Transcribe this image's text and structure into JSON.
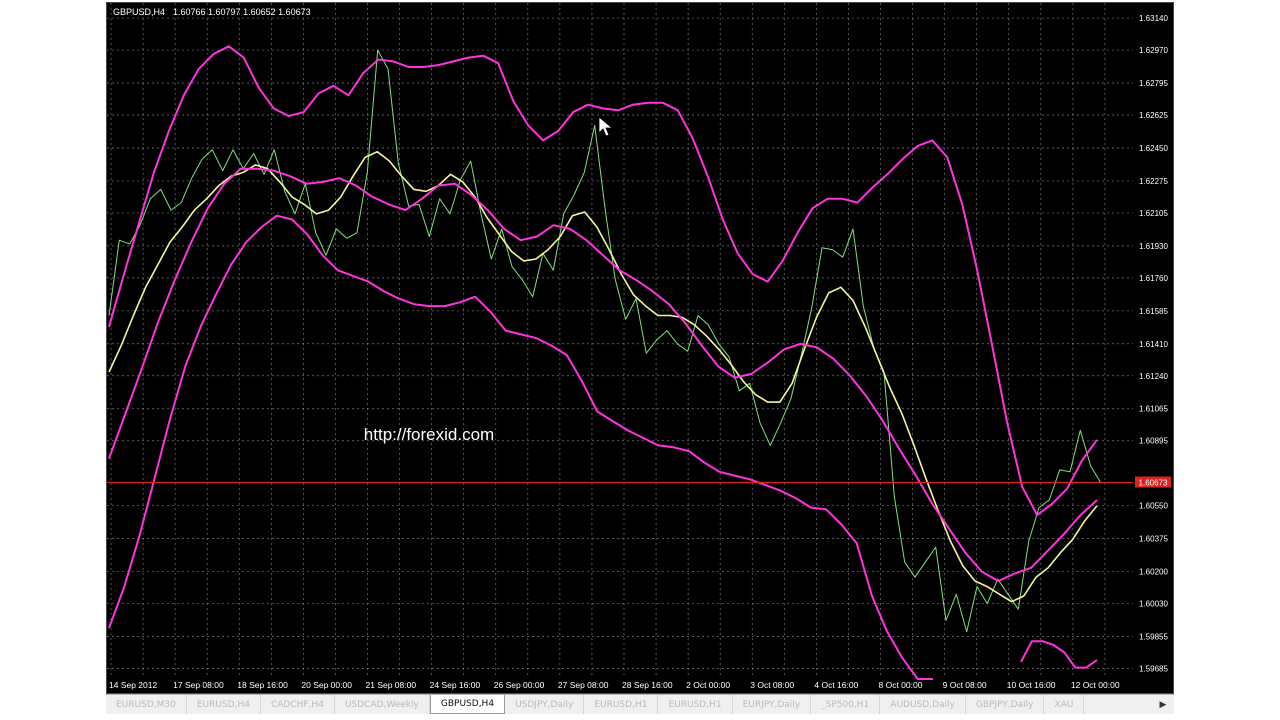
{
  "header": {
    "symbol": "GBPUSD,H4",
    "ohlc": "1.60766 1.60797 1.60652 1.60673"
  },
  "watermark": "http://forexid.com",
  "current_price_label": "1.60673",
  "tabs": [
    {
      "label": "EURUSD,M30",
      "active": false
    },
    {
      "label": "EURUSD,H4",
      "active": false
    },
    {
      "label": "CADCHF,H4",
      "active": false
    },
    {
      "label": "USDCAD,Weekly",
      "active": false
    },
    {
      "label": "GBPUSD,H4",
      "active": true
    },
    {
      "label": "USDJPY,Daily",
      "active": false
    },
    {
      "label": "EURUSD,H1",
      "active": false
    },
    {
      "label": "EURUSD,H1",
      "active": false
    },
    {
      "label": "EURJPY,Daily",
      "active": false
    },
    {
      "label": "_SP500,H1",
      "active": false
    },
    {
      "label": "AUDUSD,Daily",
      "active": false
    },
    {
      "label": "GBPJPY,Daily",
      "active": false
    },
    {
      "label": "XAU",
      "active": false
    }
  ],
  "tab_scroll_icon": "chevron-right-icon",
  "colors": {
    "background": "#000000",
    "grid": "#9aa0a6",
    "price_line": "#7fe07f",
    "ma_line": "#f5f59a",
    "band_line": "#ff33dd",
    "current_price": "#dd2222",
    "axis_text": "#ffffff"
  },
  "chart_data": {
    "type": "line",
    "y_ticks": [
      "1.63140",
      "1.62970",
      "1.62795",
      "1.62625",
      "1.62450",
      "1.62275",
      "1.62105",
      "1.61930",
      "1.61760",
      "1.61585",
      "1.61410",
      "1.61240",
      "1.61065",
      "1.60895",
      "1.60550",
      "1.60375",
      "1.60200",
      "1.60030",
      "1.59855",
      "1.59685"
    ],
    "ylim": [
      1.5964,
      1.6322
    ],
    "x_labels": [
      "14 Sep 2012",
      "17 Sep 08:00",
      "18 Sep 16:00",
      "20 Sep 00:00",
      "21 Sep 08:00",
      "24 Sep 16:00",
      "26 Sep 00:00",
      "27 Sep 08:00",
      "28 Sep 16:00",
      "2 Oct 00:00",
      "3 Oct 08:00",
      "4 Oct 16:00",
      "8 Oct 00:00",
      "9 Oct 08:00",
      "10 Oct 16:00",
      "12 Oct 00:00"
    ],
    "current_price": 1.60673,
    "grid": true,
    "series": [
      {
        "role": "price",
        "values": [
          1.6156,
          1.6196,
          1.6194,
          1.6204,
          1.6218,
          1.6223,
          1.6212,
          1.6216,
          1.6229,
          1.6239,
          1.6244,
          1.6233,
          1.6244,
          1.6234,
          1.6242,
          1.6231,
          1.6244,
          1.6222,
          1.621,
          1.6226,
          1.62,
          1.6188,
          1.6202,
          1.6197,
          1.62,
          1.6232,
          1.6297,
          1.6287,
          1.6237,
          1.6214,
          1.6215,
          1.6198,
          1.6218,
          1.621,
          1.6228,
          1.6238,
          1.621,
          1.6186,
          1.6202,
          1.6182,
          1.6175,
          1.6166,
          1.6189,
          1.618,
          1.621,
          1.622,
          1.6232,
          1.6257,
          1.6213,
          1.6175,
          1.6154,
          1.6165,
          1.6136,
          1.6143,
          1.6148,
          1.6141,
          1.6137,
          1.6156,
          1.6151,
          1.6141,
          1.6134,
          1.6116,
          1.612,
          1.6099,
          1.6087,
          1.6099,
          1.6112,
          1.6135,
          1.616,
          1.6192,
          1.6191,
          1.6187,
          1.6202,
          1.6161,
          1.6139,
          1.6126,
          1.606,
          1.6025,
          1.6017,
          1.6025,
          1.6033,
          1.5994,
          1.6008,
          1.5988,
          1.6012,
          1.6003,
          1.6016,
          1.6008,
          1.6,
          1.6036,
          1.6054,
          1.6058,
          1.6074,
          1.6073,
          1.6095,
          1.6076,
          1.6067
        ]
      },
      {
        "role": "moving-average",
        "values": [
          1.6126,
          1.614,
          1.6156,
          1.6171,
          1.6183,
          1.6195,
          1.6203,
          1.6212,
          1.6218,
          1.6225,
          1.623,
          1.6232,
          1.6236,
          1.6234,
          1.6227,
          1.6219,
          1.6215,
          1.621,
          1.6212,
          1.6219,
          1.623,
          1.624,
          1.6243,
          1.6238,
          1.623,
          1.6223,
          1.6222,
          1.6225,
          1.6231,
          1.6227,
          1.6219,
          1.6208,
          1.6199,
          1.619,
          1.6185,
          1.6186,
          1.6191,
          1.6198,
          1.6209,
          1.6211,
          1.6203,
          1.6191,
          1.6178,
          1.6167,
          1.6161,
          1.6156,
          1.6156,
          1.6155,
          1.6151,
          1.6145,
          1.6138,
          1.613,
          1.6121,
          1.6114,
          1.611,
          1.611,
          1.612,
          1.6138,
          1.6155,
          1.6168,
          1.6171,
          1.6164,
          1.615,
          1.6134,
          1.6118,
          1.6104,
          1.6087,
          1.6069,
          1.6052,
          1.6036,
          1.6023,
          1.6015,
          1.6012,
          1.6008,
          1.6004,
          1.6007,
          1.6017,
          1.6022,
          1.603,
          1.6037,
          1.6047,
          1.6055
        ]
      },
      {
        "role": "band-upper",
        "values": [
          1.615,
          1.6178,
          1.6205,
          1.6232,
          1.6254,
          1.6273,
          1.6287,
          1.6295,
          1.6299,
          1.6293,
          1.6277,
          1.6266,
          1.6262,
          1.6264,
          1.6274,
          1.6278,
          1.6273,
          1.6285,
          1.6292,
          1.6291,
          1.6288,
          1.6288,
          1.6289,
          1.6291,
          1.6293,
          1.6294,
          1.629,
          1.627,
          1.6257,
          1.6249,
          1.6254,
          1.6264,
          1.6268,
          1.6266,
          1.6265,
          1.6268,
          1.6269,
          1.6269,
          1.6265,
          1.625,
          1.623,
          1.6207,
          1.6189,
          1.6178,
          1.6174,
          1.6185,
          1.62,
          1.6213,
          1.6218,
          1.6218,
          1.6216,
          1.6224,
          1.6231,
          1.6239,
          1.6246,
          1.6249,
          1.624,
          1.6215,
          1.618,
          1.614,
          1.6099,
          1.6065,
          1.605,
          1.6056,
          1.6064,
          1.6079,
          1.609
        ]
      },
      {
        "role": "band-middle",
        "values": [
          1.608,
          1.6104,
          1.6128,
          1.6153,
          1.6175,
          1.6195,
          1.6213,
          1.6226,
          1.6234,
          1.6234,
          1.6233,
          1.623,
          1.6226,
          1.6227,
          1.6229,
          1.6225,
          1.6219,
          1.6215,
          1.6212,
          1.6218,
          1.6225,
          1.6226,
          1.622,
          1.6212,
          1.6202,
          1.6196,
          1.6198,
          1.6204,
          1.6202,
          1.6196,
          1.6188,
          1.618,
          1.6175,
          1.6169,
          1.6162,
          1.6152,
          1.614,
          1.6129,
          1.6123,
          1.6125,
          1.6131,
          1.6138,
          1.6141,
          1.6139,
          1.6133,
          1.6124,
          1.6113,
          1.61,
          1.6085,
          1.6071,
          1.6056,
          1.6043,
          1.603,
          1.602,
          1.6015,
          1.6019,
          1.6022,
          1.6031,
          1.604,
          1.605,
          1.6058
        ]
      },
      {
        "role": "band-lower",
        "values": [
          1.599,
          1.6012,
          1.6039,
          1.607,
          1.6101,
          1.6129,
          1.615,
          1.6167,
          1.6183,
          1.6195,
          1.6203,
          1.6209,
          1.6207,
          1.6199,
          1.6188,
          1.618,
          1.6177,
          1.6174,
          1.6169,
          1.6165,
          1.6162,
          1.6161,
          1.6161,
          1.6163,
          1.6166,
          1.6158,
          1.6148,
          1.6146,
          1.6144,
          1.614,
          1.6135,
          1.6121,
          1.6105,
          1.61,
          1.6095,
          1.6091,
          1.6087,
          1.6086,
          1.6084,
          1.6078,
          1.6073,
          1.6071,
          1.6069,
          1.6066,
          1.6063,
          1.6059,
          1.6054,
          1.6053,
          1.6045,
          1.6035,
          1.6007,
          1.5988,
          1.5974,
          1.5958,
          1.5934
        ]
      },
      {
        "role": "band-lower-right",
        "values": [
          1.5972,
          1.5983,
          1.5983,
          1.5981,
          1.5977,
          1.5969,
          1.5969,
          1.5973
        ]
      }
    ]
  }
}
